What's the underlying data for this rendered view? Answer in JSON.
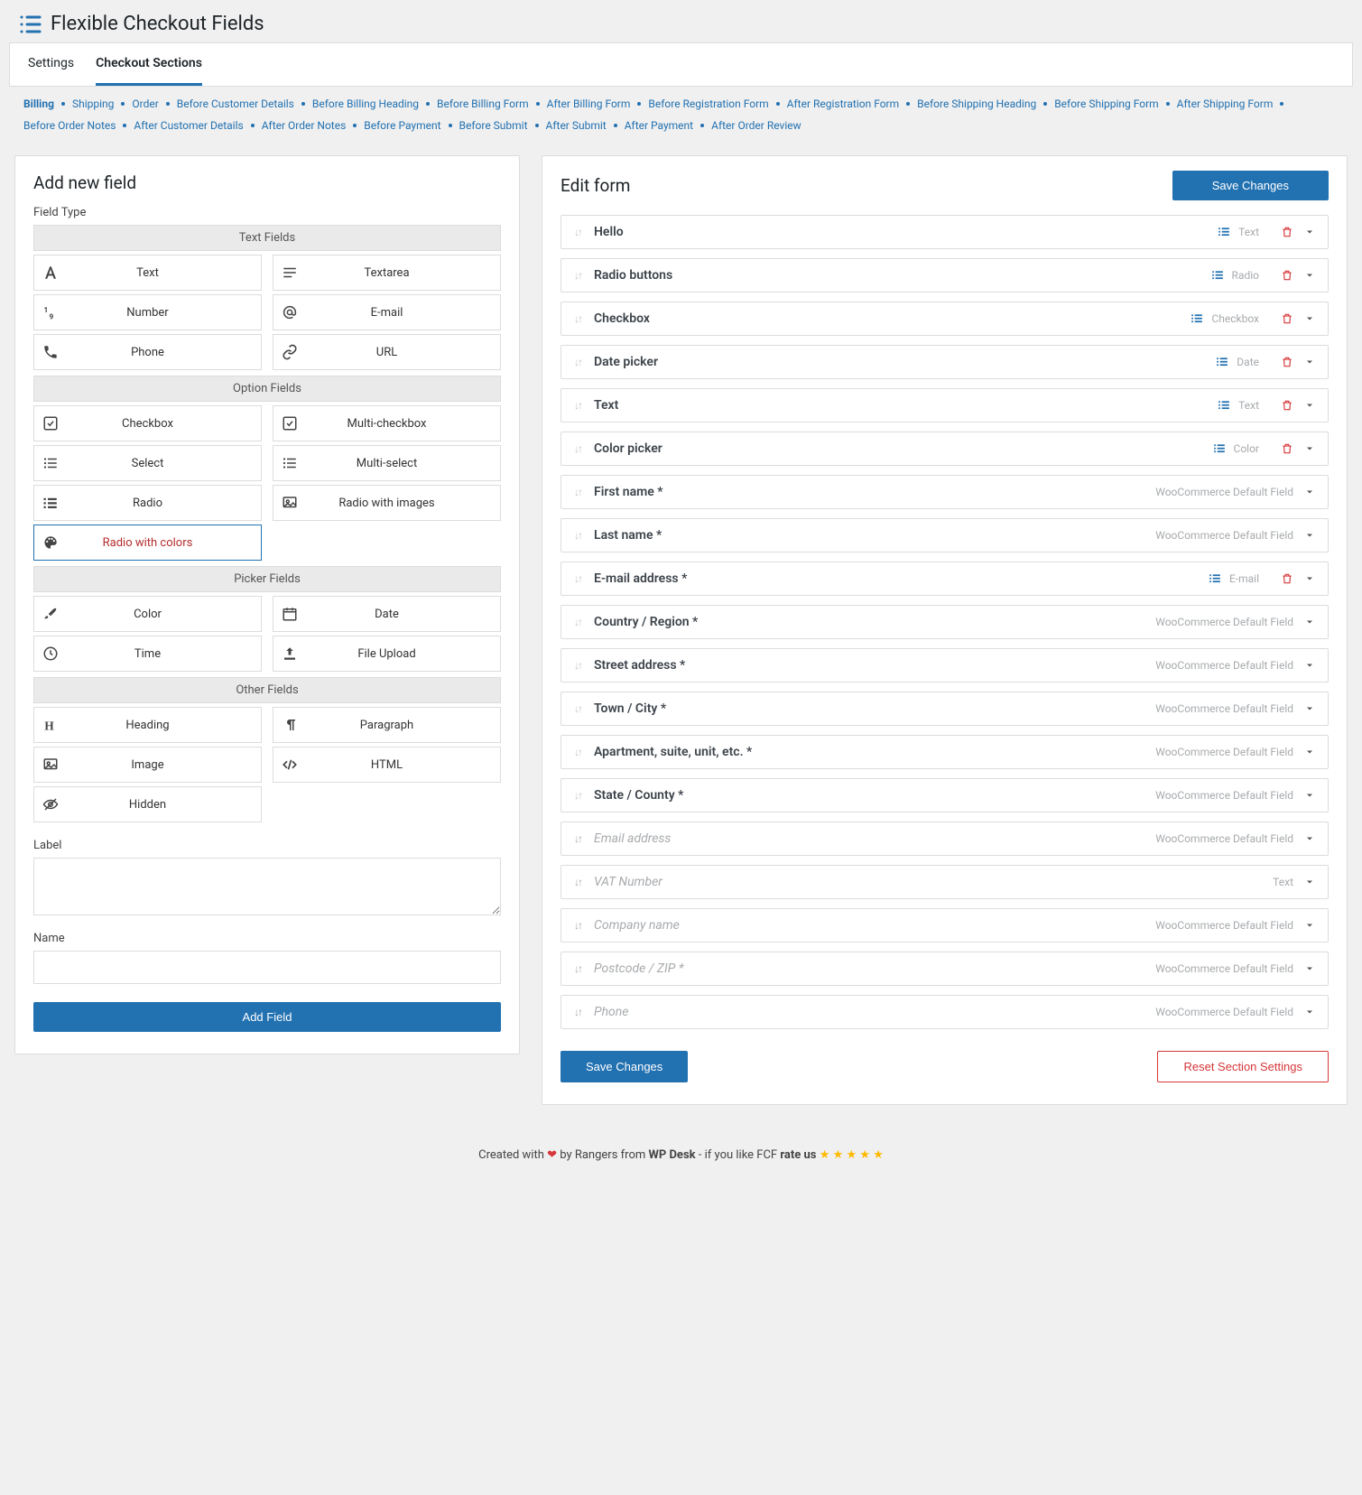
{
  "page": {
    "title": "Flexible Checkout Fields"
  },
  "tabs": [
    {
      "label": "Settings",
      "active": false
    },
    {
      "label": "Checkout Sections",
      "active": true
    }
  ],
  "sections": [
    "Billing",
    "Shipping",
    "Order",
    "Before Customer Details",
    "Before Billing Heading",
    "Before Billing Form",
    "After Billing Form",
    "Before Registration Form",
    "After Registration Form",
    "Before Shipping Heading",
    "Before Shipping Form",
    "After Shipping Form",
    "Before Order Notes",
    "After Customer Details",
    "After Order Notes",
    "Before Payment",
    "Before Submit",
    "After Submit",
    "After Payment",
    "After Order Review"
  ],
  "left": {
    "heading": "Add new field",
    "field_type_label": "Field Type",
    "groups": {
      "text": "Text Fields",
      "option": "Option Fields",
      "picker": "Picker Fields",
      "other": "Other Fields"
    },
    "types": {
      "text": "Text",
      "textarea": "Textarea",
      "number": "Number",
      "email": "E-mail",
      "phone": "Phone",
      "url": "URL",
      "checkbox": "Checkbox",
      "multi_checkbox": "Multi-checkbox",
      "select": "Select",
      "multi_select": "Multi-select",
      "radio": "Radio",
      "radio_images": "Radio with images",
      "radio_colors": "Radio with colors",
      "color": "Color",
      "date": "Date",
      "time": "Time",
      "file": "File Upload",
      "heading_t": "Heading",
      "paragraph": "Paragraph",
      "image": "Image",
      "html": "HTML",
      "hidden": "Hidden"
    },
    "label_label": "Label",
    "name_label": "Name",
    "add_button": "Add Field"
  },
  "right": {
    "heading": "Edit form",
    "save": "Save Changes",
    "reset": "Reset Section Settings",
    "rows": [
      {
        "name": "Hello",
        "tag": "Text",
        "list": true,
        "trash": true
      },
      {
        "name": "Radio buttons",
        "tag": "Radio",
        "list": true,
        "trash": true
      },
      {
        "name": "Checkbox",
        "tag": "Checkbox",
        "list": true,
        "trash": true
      },
      {
        "name": "Date picker",
        "tag": "Date",
        "list": true,
        "trash": true
      },
      {
        "name": "Text",
        "tag": "Text",
        "list": true,
        "trash": true
      },
      {
        "name": "Color picker",
        "tag": "Color",
        "list": true,
        "trash": true
      },
      {
        "name": "First name *",
        "tag": "WooCommerce Default Field"
      },
      {
        "name": "Last name *",
        "tag": "WooCommerce Default Field"
      },
      {
        "name": "E-mail address *",
        "tag": "E-mail",
        "list": true,
        "trash": true
      },
      {
        "name": "Country / Region *",
        "tag": "WooCommerce Default Field"
      },
      {
        "name": "Street address *",
        "tag": "WooCommerce Default Field"
      },
      {
        "name": "Town / City *",
        "tag": "WooCommerce Default Field"
      },
      {
        "name": "Apartment, suite, unit, etc. *",
        "tag": "WooCommerce Default Field"
      },
      {
        "name": "State / County *",
        "tag": "WooCommerce Default Field"
      },
      {
        "name": "Email address",
        "tag": "WooCommerce Default Field",
        "faded": true
      },
      {
        "name": "VAT Number",
        "tag": "Text",
        "faded": true
      },
      {
        "name": "Company name",
        "tag": "WooCommerce Default Field",
        "faded": true
      },
      {
        "name": "Postcode / ZIP *",
        "tag": "WooCommerce Default Field",
        "faded": true
      },
      {
        "name": "Phone",
        "tag": "WooCommerce Default Field",
        "faded": true
      }
    ]
  },
  "footer": {
    "prefix": "Created with ",
    "mid1": " by Rangers from ",
    "brand": "WP Desk",
    "mid2": " - if you like FCF ",
    "rate": "rate us"
  }
}
